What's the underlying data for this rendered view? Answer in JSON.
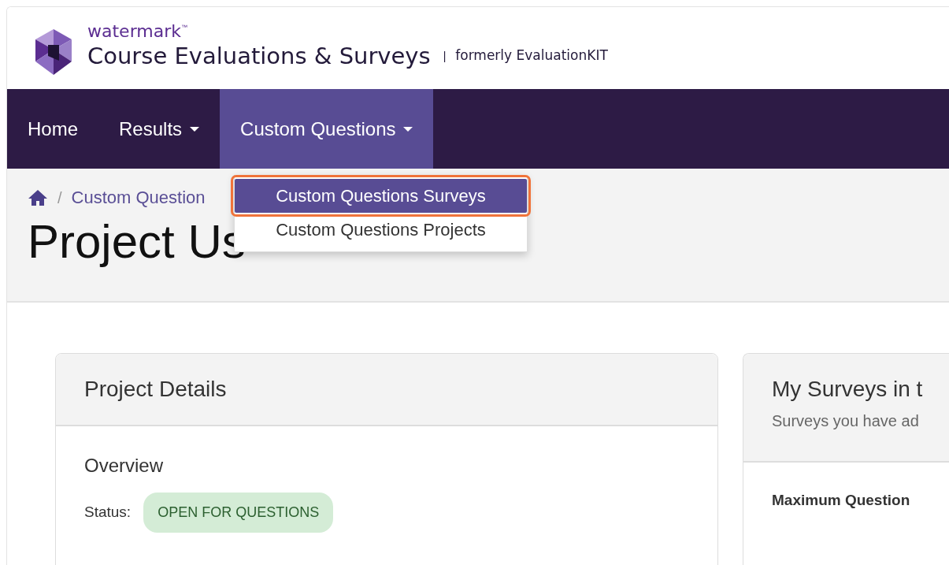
{
  "header": {
    "brand": "watermark",
    "trademark": "™",
    "product": "Course Evaluations & Surveys",
    "separator": "|",
    "tagline": "formerly EvaluationKIT"
  },
  "nav": [
    {
      "label": "Home",
      "dropdown": false,
      "selected": false
    },
    {
      "label": "Results",
      "dropdown": true,
      "selected": false
    },
    {
      "label": "Custom Questions",
      "dropdown": true,
      "selected": true
    }
  ],
  "dropdown_menu": [
    {
      "label": "Custom Questions Surveys",
      "selected": true
    },
    {
      "label": "Custom Questions Projects",
      "selected": false
    }
  ],
  "breadcrumb": [
    {
      "divider": "/",
      "label": "Custom Question"
    }
  ],
  "page_title": "Project Us",
  "project_details": {
    "title": "Project Details",
    "section": "Overview",
    "status_label": "Status:",
    "status": "OPEN FOR QUESTIONS"
  },
  "surveys_card": {
    "title": "My Surveys in t",
    "subtitle": "Surveys you have ad",
    "field_label": "Maximum Question"
  }
}
